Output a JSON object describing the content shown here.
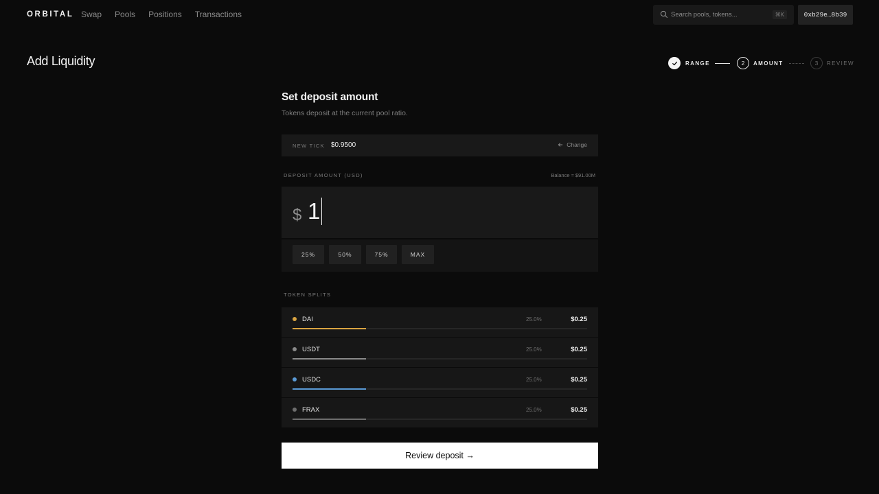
{
  "nav": {
    "brand": "ORBITAL",
    "links": [
      {
        "label": "Swap"
      },
      {
        "label": "Pools"
      },
      {
        "label": "Positions"
      },
      {
        "label": "Transactions"
      }
    ],
    "search_placeholder": "Search pools, tokens...",
    "search_shortcut": "⌘K",
    "wallet": "0xb29e…8b39"
  },
  "page": {
    "title": "Add Liquidity"
  },
  "stepper": {
    "steps": [
      {
        "number": "1",
        "label": "RANGE",
        "state": "done"
      },
      {
        "number": "2",
        "label": "AMOUNT",
        "state": "active"
      },
      {
        "number": "3",
        "label": "REVIEW",
        "state": "upcoming"
      }
    ]
  },
  "deposit": {
    "title": "Set deposit amount",
    "subtitle": "Tokens deposit at the current pool ratio.",
    "tick_label": "NEW TICK",
    "tick_value": "$0.9500",
    "change_label": "Change",
    "amount_label": "DEPOSIT AMOUNT (USD)",
    "balance": "Balance ≈ $91.00M",
    "currency_symbol": "$",
    "amount_value": "1",
    "presets": [
      "25%",
      "50%",
      "75%",
      "MAX"
    ]
  },
  "splits": {
    "label": "TOKEN SPLITS",
    "tokens": [
      {
        "name": "DAI",
        "pct": "25.0%",
        "amount": "$0.25",
        "share": 0.25,
        "color": "#d9a441"
      },
      {
        "name": "USDT",
        "pct": "25.0%",
        "amount": "$0.25",
        "share": 0.25,
        "color": "#8a8a8a"
      },
      {
        "name": "USDC",
        "pct": "25.0%",
        "amount": "$0.25",
        "share": 0.25,
        "color": "#5a9ad6"
      },
      {
        "name": "FRAX",
        "pct": "25.0%",
        "amount": "$0.25",
        "share": 0.25,
        "color": "#6e6e6e"
      }
    ]
  },
  "cta": {
    "label": "Review deposit →"
  }
}
